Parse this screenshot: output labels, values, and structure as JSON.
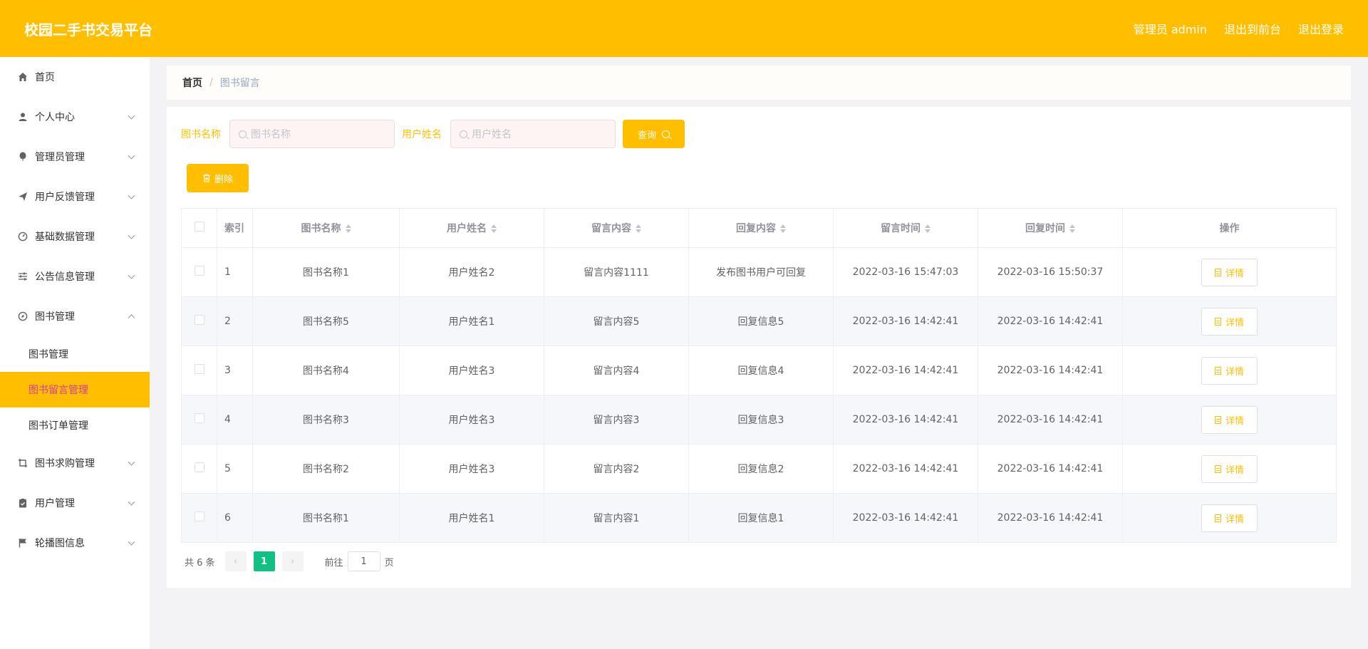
{
  "header": {
    "brand": "校园二手书交易平台",
    "admin_label": "管理员 admin",
    "to_front": "退出到前台",
    "logout": "退出登录"
  },
  "sidebar": {
    "items": [
      {
        "label": "首页",
        "icon": "home-icon",
        "expandable": false
      },
      {
        "label": "个人中心",
        "icon": "user-icon",
        "expandable": true
      },
      {
        "label": "管理员管理",
        "icon": "balloon-icon",
        "expandable": true
      },
      {
        "label": "用户反馈管理",
        "icon": "send-icon",
        "expandable": true
      },
      {
        "label": "基础数据管理",
        "icon": "gauge-icon",
        "expandable": true
      },
      {
        "label": "公告信息管理",
        "icon": "sliders-icon",
        "expandable": true
      },
      {
        "label": "图书管理",
        "icon": "compass-icon",
        "expandable": true,
        "expanded": true
      },
      {
        "label": "图书求购管理",
        "icon": "crop-icon",
        "expandable": true
      },
      {
        "label": "用户管理",
        "icon": "clipboard-icon",
        "expandable": true
      },
      {
        "label": "轮播图信息",
        "icon": "flag-icon",
        "expandable": true
      }
    ],
    "sub_items": [
      {
        "label": "图书管理",
        "active": false
      },
      {
        "label": "图书留言管理",
        "active": true
      },
      {
        "label": "图书订单管理",
        "active": false
      }
    ]
  },
  "breadcrumb": {
    "home": "首页",
    "separator": "/",
    "current": "图书留言"
  },
  "search": {
    "book_label": "图书名称",
    "book_placeholder": "图书名称",
    "user_label": "用户姓名",
    "user_placeholder": "用户姓名",
    "query_button": "查询",
    "delete_button": "删除"
  },
  "table": {
    "headers": [
      "索引",
      "图书名称",
      "用户姓名",
      "留言内容",
      "回复内容",
      "留言时间",
      "回复时间",
      "操作"
    ],
    "detail_label": "详情",
    "rows": [
      [
        "1",
        "图书名称1",
        "用户姓名2",
        "留言内容1111",
        "发布图书用户可回复",
        "2022-03-16 15:47:03",
        "2022-03-16 15:50:37"
      ],
      [
        "2",
        "图书名称5",
        "用户姓名1",
        "留言内容5",
        "回复信息5",
        "2022-03-16 14:42:41",
        "2022-03-16 14:42:41"
      ],
      [
        "3",
        "图书名称4",
        "用户姓名3",
        "留言内容4",
        "回复信息4",
        "2022-03-16 14:42:41",
        "2022-03-16 14:42:41"
      ],
      [
        "4",
        "图书名称3",
        "用户姓名3",
        "留言内容3",
        "回复信息3",
        "2022-03-16 14:42:41",
        "2022-03-16 14:42:41"
      ],
      [
        "5",
        "图书名称2",
        "用户姓名3",
        "留言内容2",
        "回复信息2",
        "2022-03-16 14:42:41",
        "2022-03-16 14:42:41"
      ],
      [
        "6",
        "图书名称1",
        "用户姓名1",
        "留言内容1",
        "回复信息1",
        "2022-03-16 14:42:41",
        "2022-03-16 14:42:41"
      ]
    ]
  },
  "pagination": {
    "total": "共 6 条",
    "current_page": "1",
    "goto_prefix": "前往",
    "goto_value": "1",
    "goto_suffix": "页"
  },
  "colors": {
    "accent": "#ffbf00",
    "active_text": "#d63aa8",
    "page_active": "#13c083"
  }
}
